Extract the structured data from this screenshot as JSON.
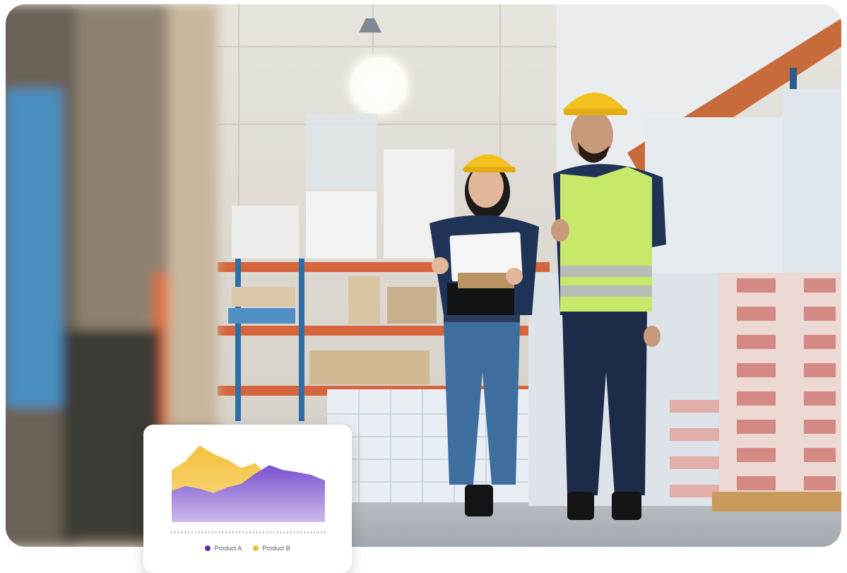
{
  "photo": {
    "subject": "warehouse-workers",
    "colors": {
      "vest": "#c8e86a",
      "helmet": "#f2c11e",
      "shelf_beam": "#e0623a",
      "boxes": "#d9908a"
    }
  },
  "chart_data": {
    "type": "area",
    "title": "",
    "xlabel": "",
    "ylabel": "",
    "x": [
      0,
      1,
      2,
      3,
      4,
      5,
      6,
      7,
      8,
      9,
      10,
      11
    ],
    "ylim": [
      0,
      120
    ],
    "series": [
      {
        "name": "Product A",
        "color": "#6a3fc2",
        "values": [
          45,
          52,
          48,
          42,
          50,
          55,
          70,
          82,
          75,
          72,
          68,
          60
        ]
      },
      {
        "name": "Product B",
        "color": "#f2c02f",
        "values": [
          75,
          88,
          110,
          98,
          90,
          78,
          85,
          62,
          58,
          65,
          58,
          60
        ]
      }
    ],
    "tick_count": 46
  }
}
